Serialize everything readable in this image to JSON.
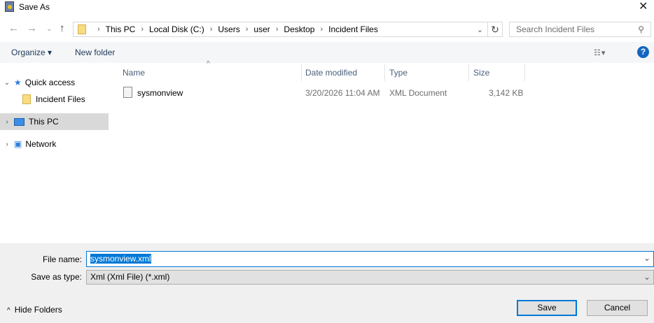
{
  "window": {
    "title": "Save As"
  },
  "address": {
    "crumbs": [
      "This PC",
      "Local Disk (C:)",
      "Users",
      "user",
      "Desktop",
      "Incident Files"
    ]
  },
  "search": {
    "placeholder": "Search Incident Files"
  },
  "toolbar": {
    "organize": "Organize",
    "new_folder": "New folder",
    "help": "?"
  },
  "sidebar": {
    "items": [
      {
        "label": "Quick access"
      },
      {
        "label": "Incident Files"
      },
      {
        "label": "This PC"
      },
      {
        "label": "Network"
      }
    ]
  },
  "columns": {
    "name": "Name",
    "date": "Date modified",
    "type": "Type",
    "size": "Size"
  },
  "files": [
    {
      "name": "sysmonview",
      "date": "3/20/2026 11:04 AM",
      "type": "XML Document",
      "size": "3,142 KB"
    }
  ],
  "form": {
    "file_name_label": "File name:",
    "file_name_value": "sysmonview.xml",
    "type_label": "Save as type:",
    "type_value": "Xml (Xml File) (*.xml)"
  },
  "footer": {
    "hide_folders": "Hide Folders",
    "save": "Save",
    "cancel": "Cancel"
  }
}
